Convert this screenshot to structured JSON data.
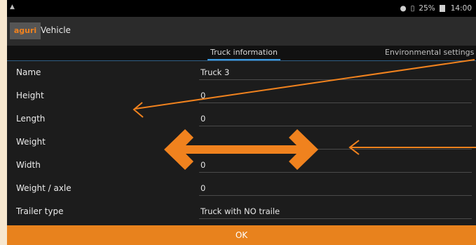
{
  "status": {
    "battery_percent": "25%",
    "time": "14:00"
  },
  "app": {
    "logo": "aguri",
    "title": "Vehicle"
  },
  "tabs": [
    {
      "label": "Truck information"
    },
    {
      "label": "Environmental settings"
    }
  ],
  "fields": [
    {
      "label": "Name",
      "value": "Truck 3"
    },
    {
      "label": "Height",
      "value": "0"
    },
    {
      "label": "Length",
      "value": "0"
    },
    {
      "label": "Weight",
      "value": ""
    },
    {
      "label": "Width",
      "value": "0"
    },
    {
      "label": "Weight / axle",
      "value": "0"
    },
    {
      "label": "Trailer type",
      "value": "Truck with NO traile"
    }
  ],
  "ok_button": {
    "label": "OK"
  },
  "annotation_color": "#f0821e"
}
